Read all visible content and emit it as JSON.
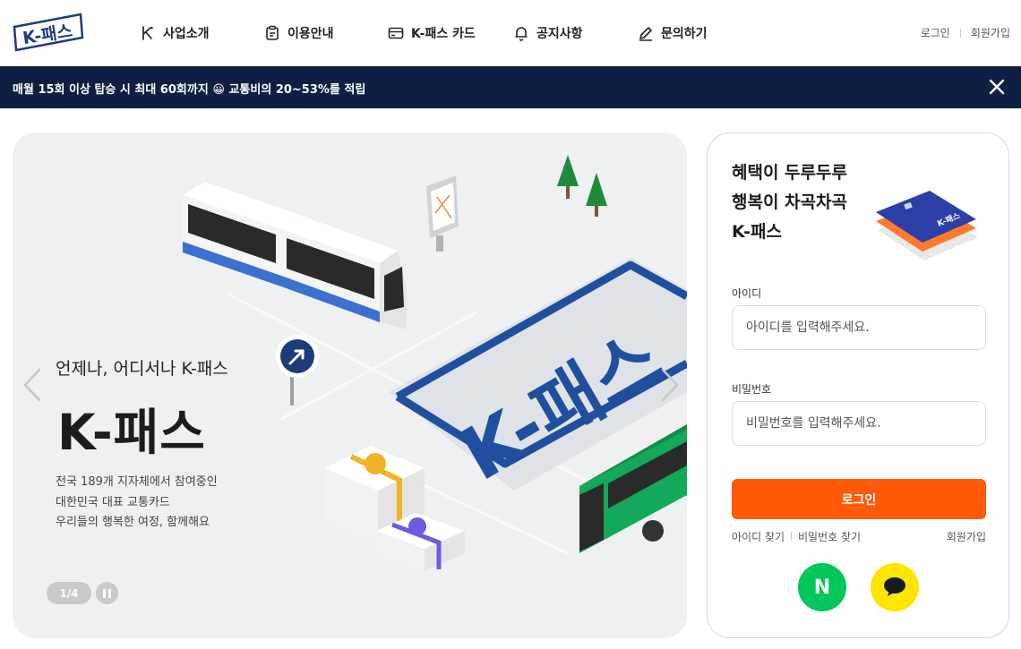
{
  "header": {
    "logo_text": "K-패스",
    "nav": [
      {
        "label": "사업소개",
        "icon": "k-logo-icon"
      },
      {
        "label": "이용안내",
        "icon": "clipboard-icon"
      },
      {
        "label": "K-패스 카드",
        "icon": "card-icon"
      },
      {
        "label": "공지사항",
        "icon": "bell-icon"
      },
      {
        "label": "문의하기",
        "icon": "pencil-icon"
      }
    ],
    "login_link": "로그인",
    "signup_link": "회원가입"
  },
  "banner": {
    "text_before": "매월 15회 이상 탑승 시 최대 60회까지",
    "emoji": "😀",
    "text_after": "교통비의 20~53%를 적립",
    "close_icon": "close-icon"
  },
  "hero": {
    "subtitle": "언제나, 어디서나 K-패스",
    "title": "K-패스",
    "desc_lines": [
      "전국 189개 지자체에서 참여중인",
      "대한민국 대표 교통카드",
      "우리들의 행복한 여정, 함께해요"
    ],
    "pager": "1/4",
    "art_text": "K-패스"
  },
  "login": {
    "promo_lines": [
      "혜택이 두루두루",
      "행복이 차곡차곡",
      "K-패스"
    ],
    "card_label": "K-패스",
    "id_label": "아이디",
    "id_placeholder": "아이디를 입력해주세요.",
    "pw_label": "비밀번호",
    "pw_placeholder": "비밀번호를 입력해주세요.",
    "button": "로그인",
    "find_id": "아이디 찾기",
    "find_pw": "비밀번호 찾기",
    "signup": "회원가입",
    "naver_label": "N"
  },
  "colors": {
    "banner_bg": "#0d2044",
    "accent": "#ff5a0a",
    "brand_blue": "#1f4f9e",
    "naver": "#03c75a",
    "kakao": "#fee500"
  }
}
